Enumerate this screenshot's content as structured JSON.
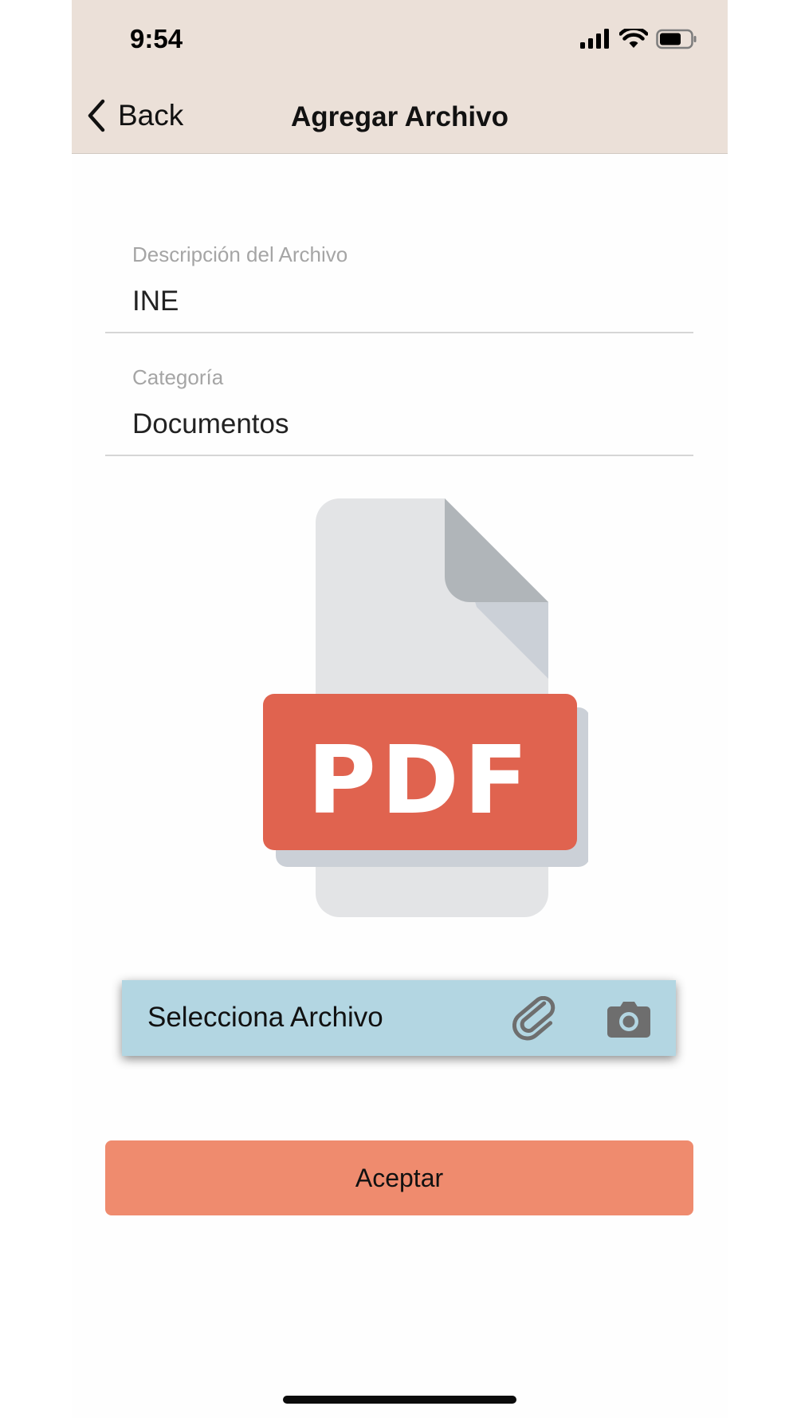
{
  "status_bar": {
    "time": "9:54",
    "icons": [
      "signal-icon",
      "wifi-icon",
      "battery-icon"
    ]
  },
  "nav": {
    "back_label": "Back",
    "title": "Agregar Archivo",
    "back_icon": "chevron-left-icon"
  },
  "form": {
    "description": {
      "label": "Descripción del Archivo",
      "value": "INE"
    },
    "category": {
      "label": "Categoría",
      "value": "Documentos"
    }
  },
  "preview": {
    "icon": "pdf-file-icon",
    "badge_text": "PDF"
  },
  "file_picker": {
    "label": "Selecciona Archivo",
    "attach_icon": "paperclip-icon",
    "camera_icon": "camera-icon"
  },
  "actions": {
    "accept_label": "Aceptar"
  },
  "colors": {
    "header_bg": "#ebe0d8",
    "picker_bg": "#b3d6e2",
    "accept_bg": "#ef8b6e",
    "pdf_red": "#e0634f",
    "page_gray": "#e3e4e6"
  }
}
